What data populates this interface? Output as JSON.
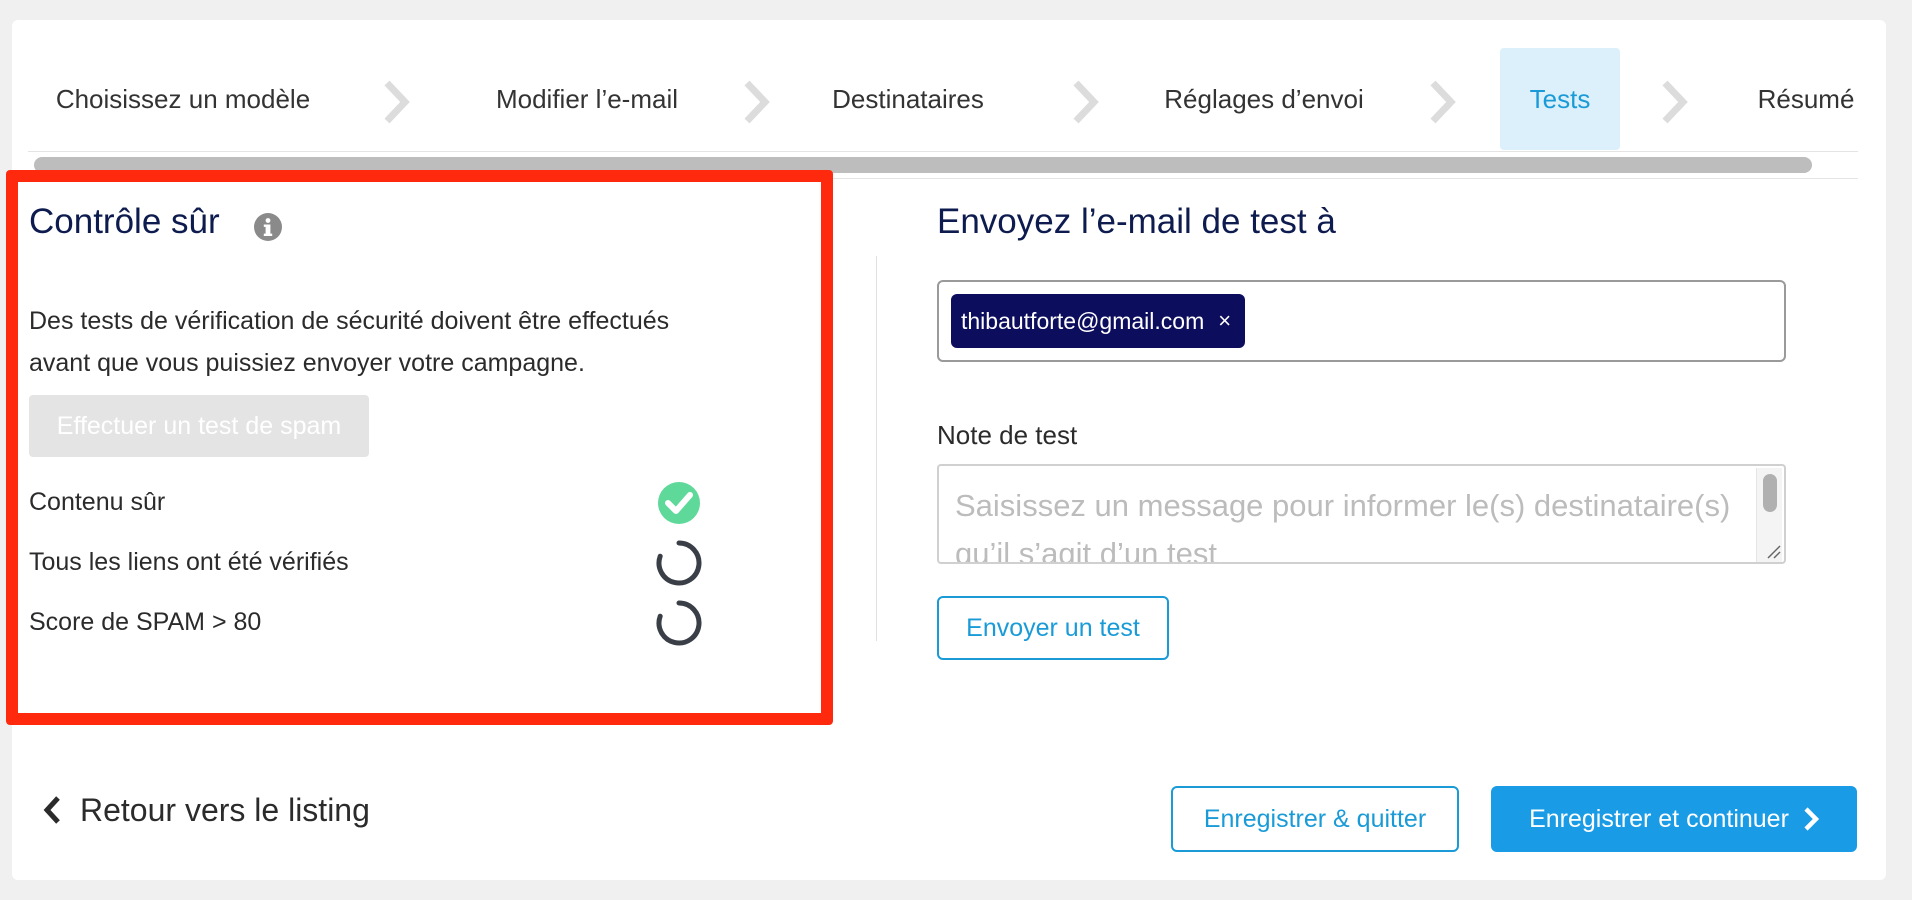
{
  "stepper": {
    "steps": [
      {
        "label": "Choisissez un modèle"
      },
      {
        "label": "Modifier l’e-mail"
      },
      {
        "label": "Destinataires"
      },
      {
        "label": "Réglages d’envoi"
      },
      {
        "label": "Tests",
        "active": true
      },
      {
        "label": "Résumé"
      }
    ]
  },
  "safety_check": {
    "title": "Contrôle sûr",
    "description": "Des tests de vérification de sécurité doivent être effectués avant que vous puissiez envoyer votre campagne.",
    "spam_test_button": "Effectuer un test de spam",
    "checks": [
      {
        "label": "Contenu sûr",
        "status": "passed"
      },
      {
        "label": "Tous les liens ont été vérifiés",
        "status": "loading"
      },
      {
        "label": "Score de SPAM > 80",
        "status": "loading"
      }
    ]
  },
  "send_test": {
    "title": "Envoyez l’e-mail de test à",
    "recipients": [
      {
        "email": "thibautforte@gmail.com",
        "remove": "×"
      }
    ],
    "note_label": "Note de test",
    "note_placeholder": "Saisissez un message pour informer le(s) destinataire(s) qu’il s’agit d’un test",
    "send_button": "Envoyer un test"
  },
  "footer": {
    "back_label": "Retour vers le listing",
    "save_quit_label": "Enregistrer & quitter",
    "save_continue_label": "Enregistrer et continuer"
  },
  "colors": {
    "accent": "#1a9bd7",
    "title_navy": "#0d1b4e",
    "chip_bg": "#0d0d5e",
    "highlight_red": "#ff2a0e",
    "success_green": "#5ed99a",
    "active_step_bg": "#dcf0fb"
  },
  "icons": {
    "info": "info-icon",
    "check": "check-circle-icon",
    "spinner": "spinner-icon",
    "chevron": "chevron-right-icon",
    "back": "chevron-left-icon"
  }
}
